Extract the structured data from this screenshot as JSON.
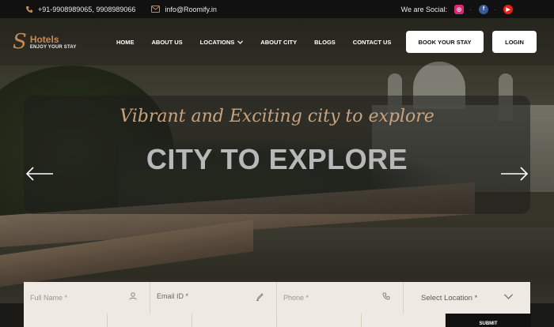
{
  "topbar": {
    "phone_icon": "phone-icon",
    "phone": "+91-9908989065, 9908989066",
    "mail_icon": "mail-icon",
    "email": "info@Roomify.in",
    "social_label": "We are Social:",
    "social": [
      {
        "name": "instagram-icon",
        "glyph": "◎",
        "color": "#d62976"
      },
      {
        "name": "facebook-icon",
        "glyph": "f",
        "color": "#3b5998"
      },
      {
        "name": "youtube-icon",
        "glyph": "▶",
        "color": "#e62117"
      }
    ]
  },
  "nav": {
    "logo_mark": "S",
    "brand": "Hotels",
    "tagline": "ENJOY YOUR STAY",
    "menu": [
      {
        "label": "HOME"
      },
      {
        "label": "ABOUT US"
      },
      {
        "label": "LOCATIONS",
        "has_dropdown": true
      },
      {
        "label": "ABOUT CITY"
      },
      {
        "label": "BLOGS"
      },
      {
        "label": "CONTACT US"
      }
    ],
    "book_button": "BOOK YOUR STAY",
    "login_button": "LOGIN"
  },
  "hero": {
    "subtitle": "Vibrant and Exciting city to explore",
    "title": "CITY TO EXPLORE",
    "prev_icon": "arrow-left-icon",
    "next_icon": "arrow-right-icon"
  },
  "form": {
    "full_name": "Full Name *",
    "email": "Email ID *",
    "phone": "Phone *",
    "location": "Select Location *",
    "submit": "SUBMIT"
  },
  "colors": {
    "accent": "#c58a55",
    "topbar_bg": "#111111",
    "form_bg": "#eee9e3"
  }
}
